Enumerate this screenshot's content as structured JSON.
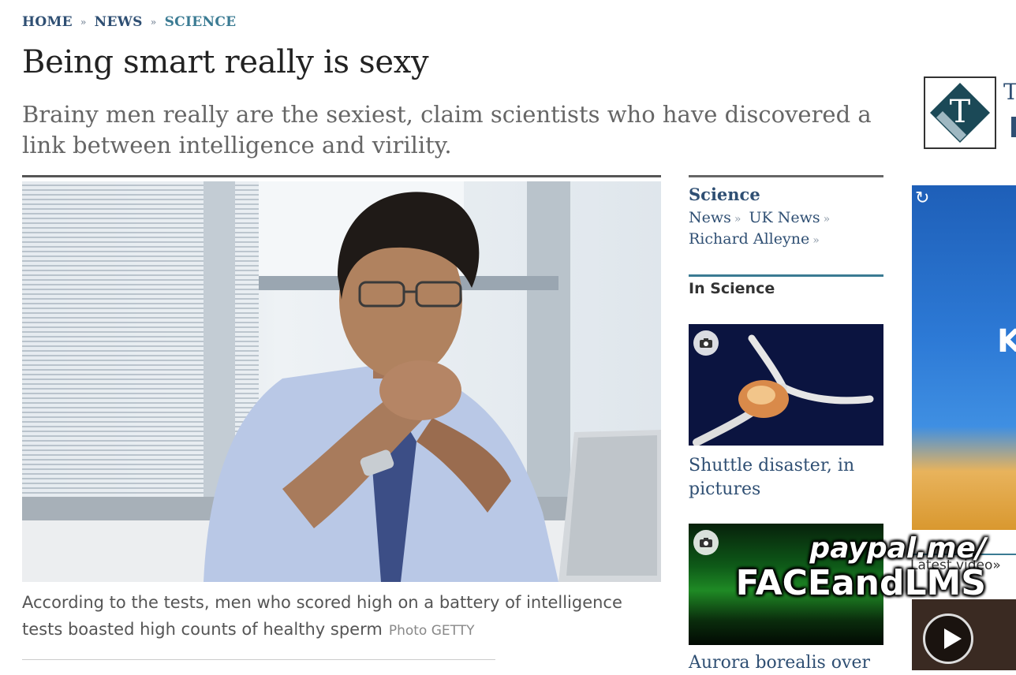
{
  "breadcrumb": {
    "home": "HOME",
    "news": "NEWS",
    "science": "SCIENCE",
    "sep": "»"
  },
  "article": {
    "title": "Being smart really is sexy",
    "standfirst": "Brainy men really are the sexiest, claim scientists who have discovered a link between intelligence and virility.",
    "caption": "According to the tests, men who scored high on a battery of intelligence tests boasted high counts of healthy sperm",
    "credit": "Photo  GETTY"
  },
  "sidebar": {
    "section_title": "Science",
    "links": [
      {
        "label": "News",
        "arrow": "»"
      },
      {
        "label": "UK News",
        "arrow": "»"
      },
      {
        "label": "Richard Alleyne",
        "arrow": "»"
      }
    ],
    "in_section": "In Science",
    "items": [
      {
        "caption": "Shuttle disaster, in pictures"
      },
      {
        "caption": "Aurora borealis over"
      }
    ]
  },
  "far_right": {
    "logo_text": "T",
    "ad_letter": "K",
    "latest_video": "Latest video»"
  },
  "watermark": {
    "line1": "paypal.me/",
    "line2": "FACEandLMS"
  },
  "colors": {
    "link": "#2f4f73",
    "accent": "#3b7b93"
  }
}
